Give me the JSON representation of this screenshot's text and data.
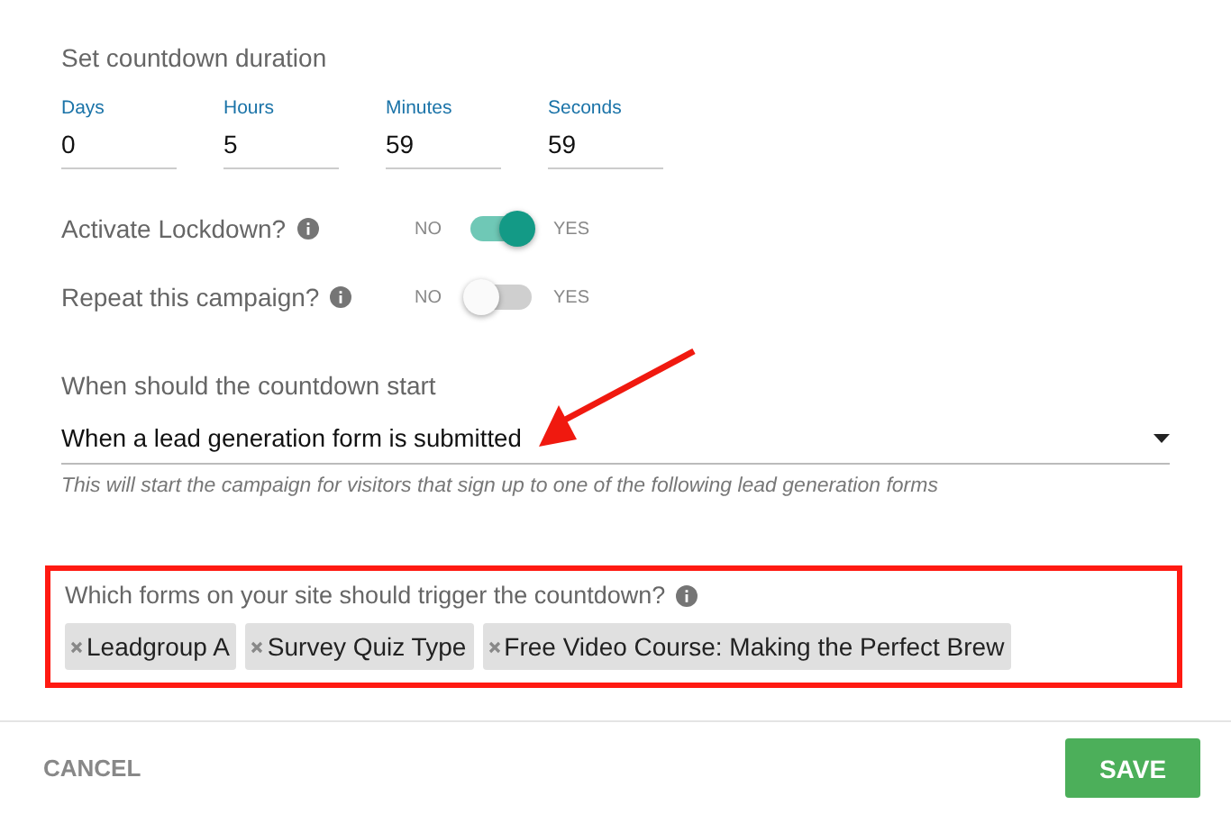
{
  "title": "Set countdown duration",
  "duration": [
    {
      "label": "Days",
      "value": "0"
    },
    {
      "label": "Hours",
      "value": "5"
    },
    {
      "label": "Minutes",
      "value": "59"
    },
    {
      "label": "Seconds",
      "value": "59"
    }
  ],
  "toggles": [
    {
      "label": "Activate Lockdown?",
      "off_label": "NO",
      "on_label": "YES",
      "on": true
    },
    {
      "label": "Repeat this campaign?",
      "off_label": "NO",
      "on_label": "YES",
      "on": false
    }
  ],
  "start": {
    "label": "When should the countdown start",
    "value": "When a lead generation form is submitted",
    "helper": "This will start the campaign for visitors that sign up to one of the following lead generation forms"
  },
  "forms": {
    "label": "Which forms on your site should trigger the countdown?",
    "highlighted": true,
    "tags": [
      "Leadgroup A",
      "Survey Quiz Type",
      "Free Video Course: Making the Perfect Brew"
    ]
  },
  "buttons": {
    "cancel": "CANCEL",
    "save": "SAVE"
  }
}
